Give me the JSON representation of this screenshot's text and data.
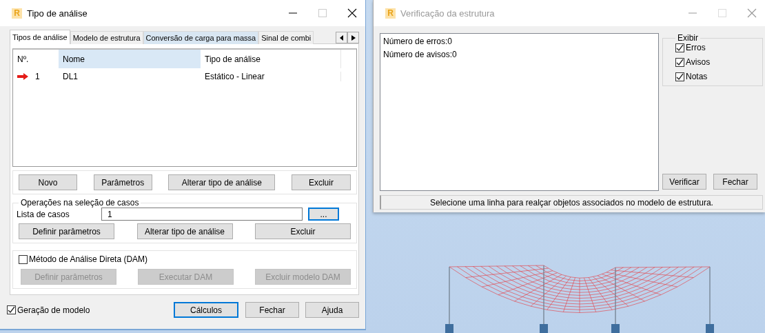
{
  "analysis_dialog": {
    "logo": "R",
    "title": "Tipo de análise",
    "active": true,
    "tabs": [
      {
        "label": "Tipos de análise",
        "selected": true,
        "hovered": false
      },
      {
        "label": "Modelo de estrutura",
        "selected": false,
        "hovered": false
      },
      {
        "label": "Conversão de carga para massa",
        "selected": false,
        "hovered": true
      },
      {
        "label": "Sinal de combi",
        "selected": false,
        "hovered": false
      }
    ],
    "table": {
      "columns": [
        {
          "label": "Nº.",
          "highlighted": false
        },
        {
          "label": "Nome",
          "highlighted": true
        },
        {
          "label": "Tipo de análise",
          "highlighted": false
        }
      ],
      "rows": [
        {
          "current": true,
          "cells": [
            "1",
            "DL1",
            "Estático - Linear"
          ]
        }
      ]
    },
    "case_buttons": [
      "Novo",
      "Parâmetros",
      "Alterar tipo de análise",
      "Excluir"
    ],
    "case_operations": {
      "title": "Operações na seleção de casos",
      "list_label": "Lista de casos",
      "list_value": "1",
      "browse_button": "...",
      "buttons": [
        "Definir parâmetros",
        "Alterar tipo de análise",
        "Excluir"
      ]
    },
    "dam": {
      "label": "Método de Análise Direta (DAM)",
      "checked": false,
      "buttons": [
        {
          "label": "Definir parâmetros",
          "disabled": true
        },
        {
          "label": "Executar DAM",
          "disabled": true
        },
        {
          "label": "Excluir modelo DAM",
          "disabled": true
        }
      ]
    },
    "model_generation": {
      "label": "Geração de modelo",
      "checked": true
    },
    "footer_buttons": [
      {
        "label": "Cálculos",
        "default": true
      },
      {
        "label": "Fechar",
        "default": false
      },
      {
        "label": "Ajuda",
        "default": false
      }
    ]
  },
  "check_dialog": {
    "logo": "R",
    "title": "Verificação da estrutura",
    "active": false,
    "messages": [
      "Número de erros:0",
      "Número de avisos:0"
    ],
    "show": {
      "title": "Exibir",
      "options": [
        {
          "label": "Erros",
          "checked": true
        },
        {
          "label": "Avisos",
          "checked": true
        },
        {
          "label": "Notas",
          "checked": true
        }
      ]
    },
    "buttons": [
      "Verificar",
      "Fechar"
    ],
    "status": "Selecione uma linha para realçar objetos associados no modelo de estrutura."
  }
}
